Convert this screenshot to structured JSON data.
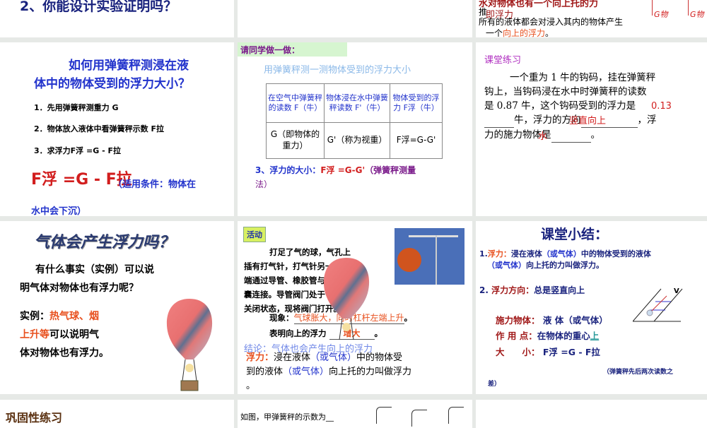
{
  "slides": {
    "s1": {
      "text": "2、你能设计实验证明吗？"
    },
    "s3": {
      "line1": "水对物体也有一个向上托的力",
      "line2": "推",
      "line3": "即浮力",
      "line4": "所有的液体都会对浸入其内的物体产生",
      "line5a": "一个",
      "line5b": "向上的浮力",
      "line5c": "。",
      "g1": "G物",
      "g2": "G物"
    },
    "s4": {
      "title1": "如何用弹簧秤测浸在液",
      "title2": "体中的物体受到的浮力大小？",
      "step1": "1．先用弹簧秤测重力 G",
      "step2": "2．物体放入液体中看弹簧秤示数 F拉",
      "step3": "3．求浮力F浮 =G - F拉",
      "formula": "F浮 =G - F拉",
      "cond1": "（适用条件：物体在",
      "cond2": "水中会下沉）"
    },
    "s5": {
      "header": "请同学做一做：",
      "subtitle": "用弹簧秤测一测物体受到的浮力大小",
      "table": {
        "headers": [
          "在空气中弹簧秤的读数 F（牛）",
          "物体浸在水中弹簧秤读数 F'（牛）",
          "物体受到的浮力 F浮（牛）"
        ],
        "row": [
          "G（即物体的重力）",
          "G'（称为视重）",
          "F浮=G-G'"
        ]
      },
      "line1a": "3、浮力的大小：",
      "line1b": "F浮 =G-G'",
      "line1c": "（弹簧秤测量",
      "line2": "法）"
    },
    "s6": {
      "title": "课堂练习",
      "p1": "一个重为 1 牛的钩码，挂在弹簧秤",
      "p2": "钩上，当钩码浸在水中时弹簧秤的读数",
      "p3": "是 0.87 牛，这个钩码受到的浮力是",
      "p4a": "牛，浮力的方向",
      "p4b": "，浮",
      "p5": "力的施力物体是",
      "p5end": "。",
      "a1": "0.13",
      "a2": "竖直向上",
      "a3": "水"
    },
    "s7": {
      "title": "气体会产生浮力吗？",
      "q1": "有什么事实（实例）可以说",
      "q2": "明气体对物体也有浮力呢？",
      "e1a": "实例：",
      "e1b": "热气球、烟",
      "e2a": "上升等",
      "e2b": "可以说明气",
      "e3": "体对物体也有浮力。"
    },
    "s8": {
      "badge": "活动",
      "p1": "打足了气的球，气孔上",
      "p2": "插有打气针，打气针另一",
      "p3": "端通过导管、橡胶管与气球",
      "p4": "囊连接。导管阀门处于",
      "p5": "关闭状态，现将阀门打开。",
      "obs_label": "现象：",
      "obs": "气球胀大，同时杠杆左端上升",
      "obs_end": "。",
      "res_label": "表明向上的浮力",
      "res": "增大",
      "res_end": "。",
      "concl": "结论：气体也会产生向上的浮力",
      "def1a": "浮力：",
      "def1b": "浸在液体",
      "def1c": "（或气体）",
      "def1d": "中的物体受",
      "def2a": "到的液体",
      "def2b": "（或气体）",
      "def2c": "向上托的力叫做浮力",
      "def3": "。"
    },
    "s9": {
      "title": "课堂小结：",
      "l1a": "1.",
      "l1b": "浮力：",
      "l1c": "浸在液体",
      "l1d": "（或气体）",
      "l1e": "中的物体受到的液体",
      "l2a": "（或气体）",
      "l2b": "向上托的力叫做浮力。",
      "l3a": "2.",
      "l3b": "浮力方向：",
      "l3c": "总是竖直向上",
      "l4a": "施力物体：",
      "l4b": "液 体（或气体）",
      "l5a": "作 用 点：",
      "l5b": "在物体的重心",
      "l5c": "上",
      "l6a": "大　　小：",
      "l6b": "F浮 =G - F拉",
      "l7": "（弹簧秤先后两次读数之",
      "l8": "差）",
      "v": "V"
    },
    "s10": {
      "title": "巩固性练习"
    },
    "s11": {
      "text": "如图，甲弹簧秤的示数为__"
    }
  }
}
